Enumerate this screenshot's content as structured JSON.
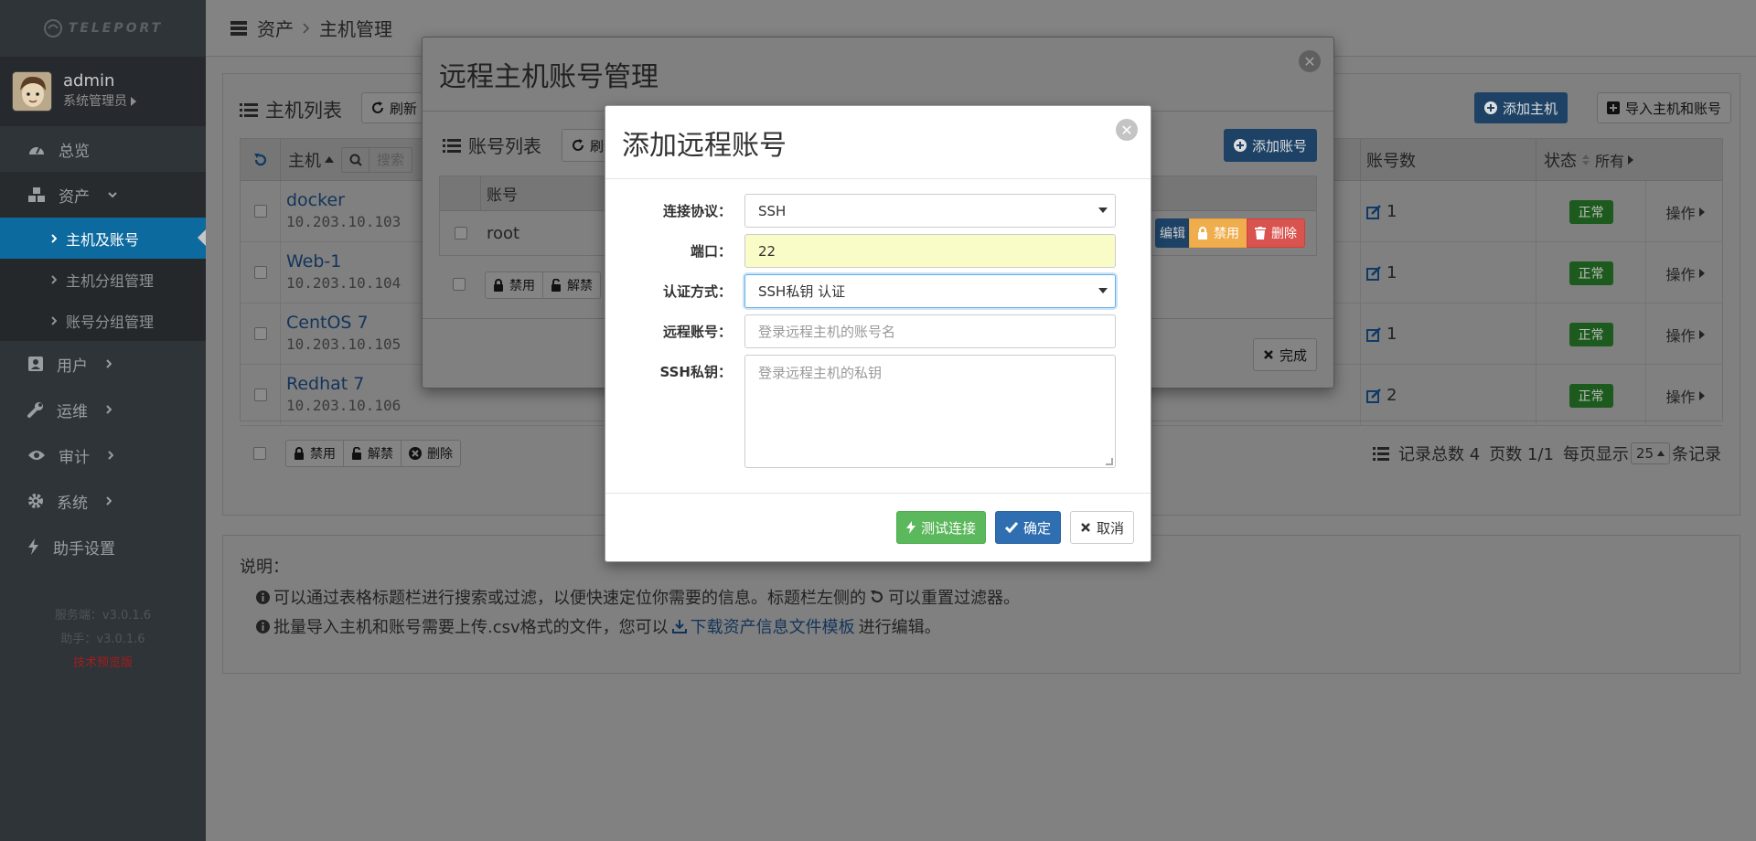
{
  "sidebar": {
    "logo": "TELEPORT",
    "user": {
      "name": "admin",
      "role": "系统管理员"
    },
    "nav": {
      "dashboard": "总览",
      "assets": "资产",
      "hosts_accounts": "主机及账号",
      "host_groups": "主机分组管理",
      "account_groups": "账号分组管理",
      "users": "用户",
      "ops": "运维",
      "audit": "审计",
      "system": "系统",
      "assist": "助手设置"
    },
    "version": {
      "server": "服务端：v3.0.1.6",
      "assist": "助手：v3.0.1.6",
      "tech": "技术预览版"
    }
  },
  "breadcrumb": {
    "section": "资产",
    "page": "主机管理"
  },
  "host_list": {
    "title": "主机列表",
    "refresh": "刷新",
    "search_placeholder": "搜索",
    "add_host": "添加主机",
    "import": "导入主机和账号",
    "columns": {
      "host": "主机",
      "account_count": "账号数",
      "status": "状态",
      "filter_all": "所有"
    },
    "rows": [
      {
        "name": "docker",
        "ip": "10.203.10.103",
        "accounts": "1",
        "status": "正常",
        "op": "操作"
      },
      {
        "name": "Web-1",
        "ip": "10.203.10.104",
        "accounts": "1",
        "status": "正常",
        "op": "操作"
      },
      {
        "name": "CentOS 7",
        "ip": "10.203.10.105",
        "accounts": "1",
        "status": "正常",
        "op": "操作"
      },
      {
        "name": "Redhat 7",
        "ip": "10.203.10.106",
        "accounts": "2",
        "status": "正常",
        "op": "操作"
      }
    ],
    "bulk": {
      "disable": "禁用",
      "unlock": "解禁",
      "delete": "删除"
    },
    "pager": {
      "total": "记录总数 4",
      "pages": "页数 1/1",
      "per_page_label": "每页显示",
      "per_page": "25",
      "suffix": "条记录"
    }
  },
  "notes": {
    "title": "说明：",
    "line1_a": "可以通过表格标题栏进行搜索或过滤，以便快速定位你需要的信息。标题栏左侧的",
    "line1_b": "可以重置过滤器。",
    "line2_a": "批量导入主机和账号需要上传.csv格式的文件，您可以",
    "line2_link": "下载资产信息文件模板",
    "line2_b": "进行编辑。"
  },
  "account_modal": {
    "title": "远程主机账号管理",
    "list_title": "账号列表",
    "refresh": "刷新",
    "add_account": "添加账号",
    "col_account": "账号",
    "rows": [
      {
        "account": "root"
      }
    ],
    "row_actions": {
      "edit": "编辑",
      "disable": "禁用",
      "delete": "删除"
    },
    "bulk": {
      "disable": "禁用",
      "unlock": "解禁"
    },
    "done": "完成"
  },
  "add_modal": {
    "title": "添加远程账号",
    "protocol_label": "连接协议：",
    "protocol_value": "SSH",
    "port_label": "端口：",
    "port_value": "22",
    "auth_label": "认证方式：",
    "auth_value": "SSH私钥 认证",
    "account_label": "远程账号：",
    "account_placeholder": "登录远程主机的账号名",
    "key_label": "SSH私钥：",
    "key_placeholder": "登录远程主机的私钥",
    "test_button": "测试连接",
    "ok_button": "确定",
    "cancel_button": "取消"
  },
  "colors": {
    "primary": "#2f6fb1",
    "success": "#5cb85c",
    "warning": "#f0ad4e",
    "danger": "#d9534f",
    "sidebar_active": "#0d6a9f"
  }
}
